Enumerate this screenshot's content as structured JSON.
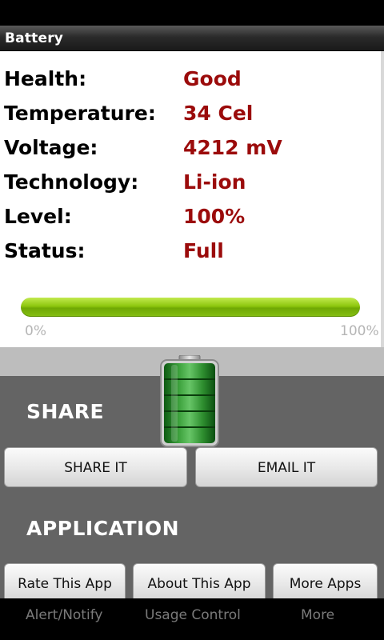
{
  "titlebar": {
    "title": "Battery"
  },
  "info": [
    {
      "label": "Health:",
      "value": "Good"
    },
    {
      "label": "Temperature:",
      "value": "34 Cel"
    },
    {
      "label": "Voltage:",
      "value": "4212 mV"
    },
    {
      "label": "Technology:",
      "value": "Li-ion"
    },
    {
      "label": "Level:",
      "value": "100%"
    },
    {
      "label": "Status:",
      "value": "Full"
    }
  ],
  "progress": {
    "level_fraction": 1.0,
    "min_label": "0%",
    "max_label": "100%"
  },
  "share": {
    "title": "SHARE",
    "share_button": "SHARE IT",
    "email_button": "EMAIL IT"
  },
  "application": {
    "title": "APPLICATION",
    "rate_button": "Rate This App",
    "about_button": "About This App",
    "more_button": "More Apps"
  },
  "tabs": [
    "Alert/Notify",
    "Usage Control",
    "More"
  ],
  "colors": {
    "value_red": "#9b0b0b",
    "progress_green": "#8dc60d",
    "panel_gray": "#646464"
  },
  "icons": {
    "battery": "battery-icon"
  }
}
